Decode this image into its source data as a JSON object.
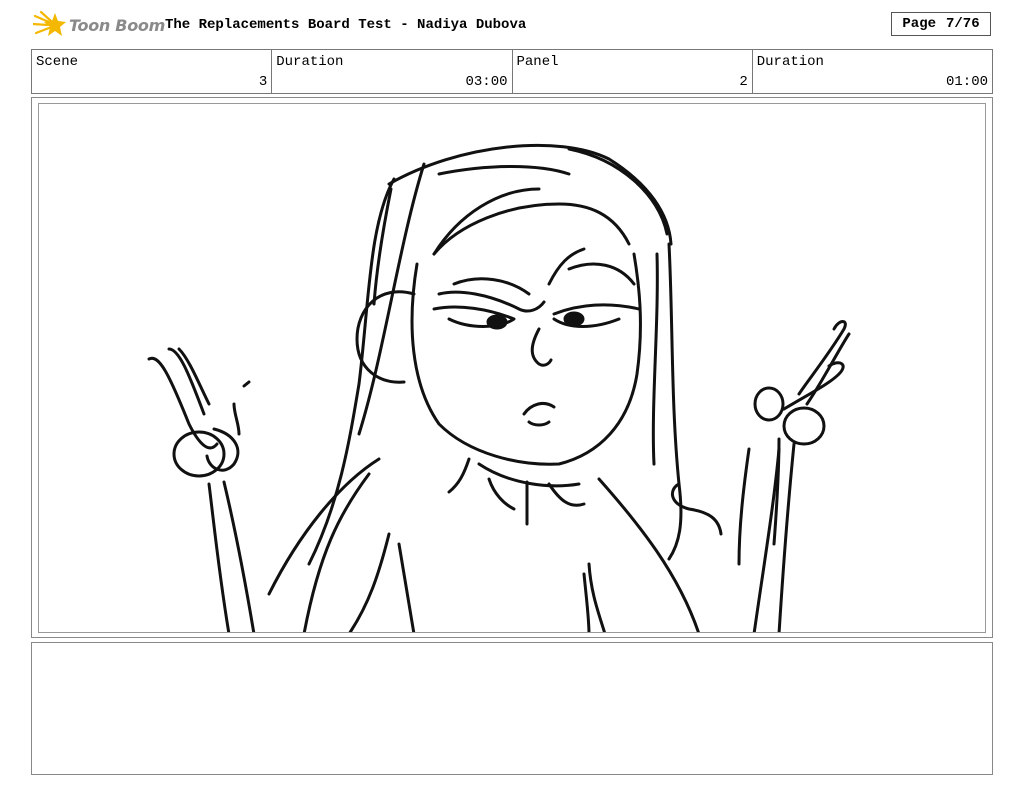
{
  "header": {
    "logo_text": "Toon Boom",
    "title": "The Replacements Board Test - Nadiya Dubova",
    "page_label": "Page",
    "page_value": "7/76"
  },
  "info": {
    "scene_label": "Scene",
    "scene_value": "3",
    "scene_duration_label": "Duration",
    "scene_duration_value": "03:00",
    "panel_label": "Panel",
    "panel_value": "2",
    "panel_duration_label": "Duration",
    "panel_duration_value": "01:00"
  },
  "colors": {
    "logo_star": "#f5b800",
    "logo_text": "#8a8a8a",
    "border": "#777777"
  },
  "icons": {
    "logo": "toon-boom-star-logo"
  }
}
